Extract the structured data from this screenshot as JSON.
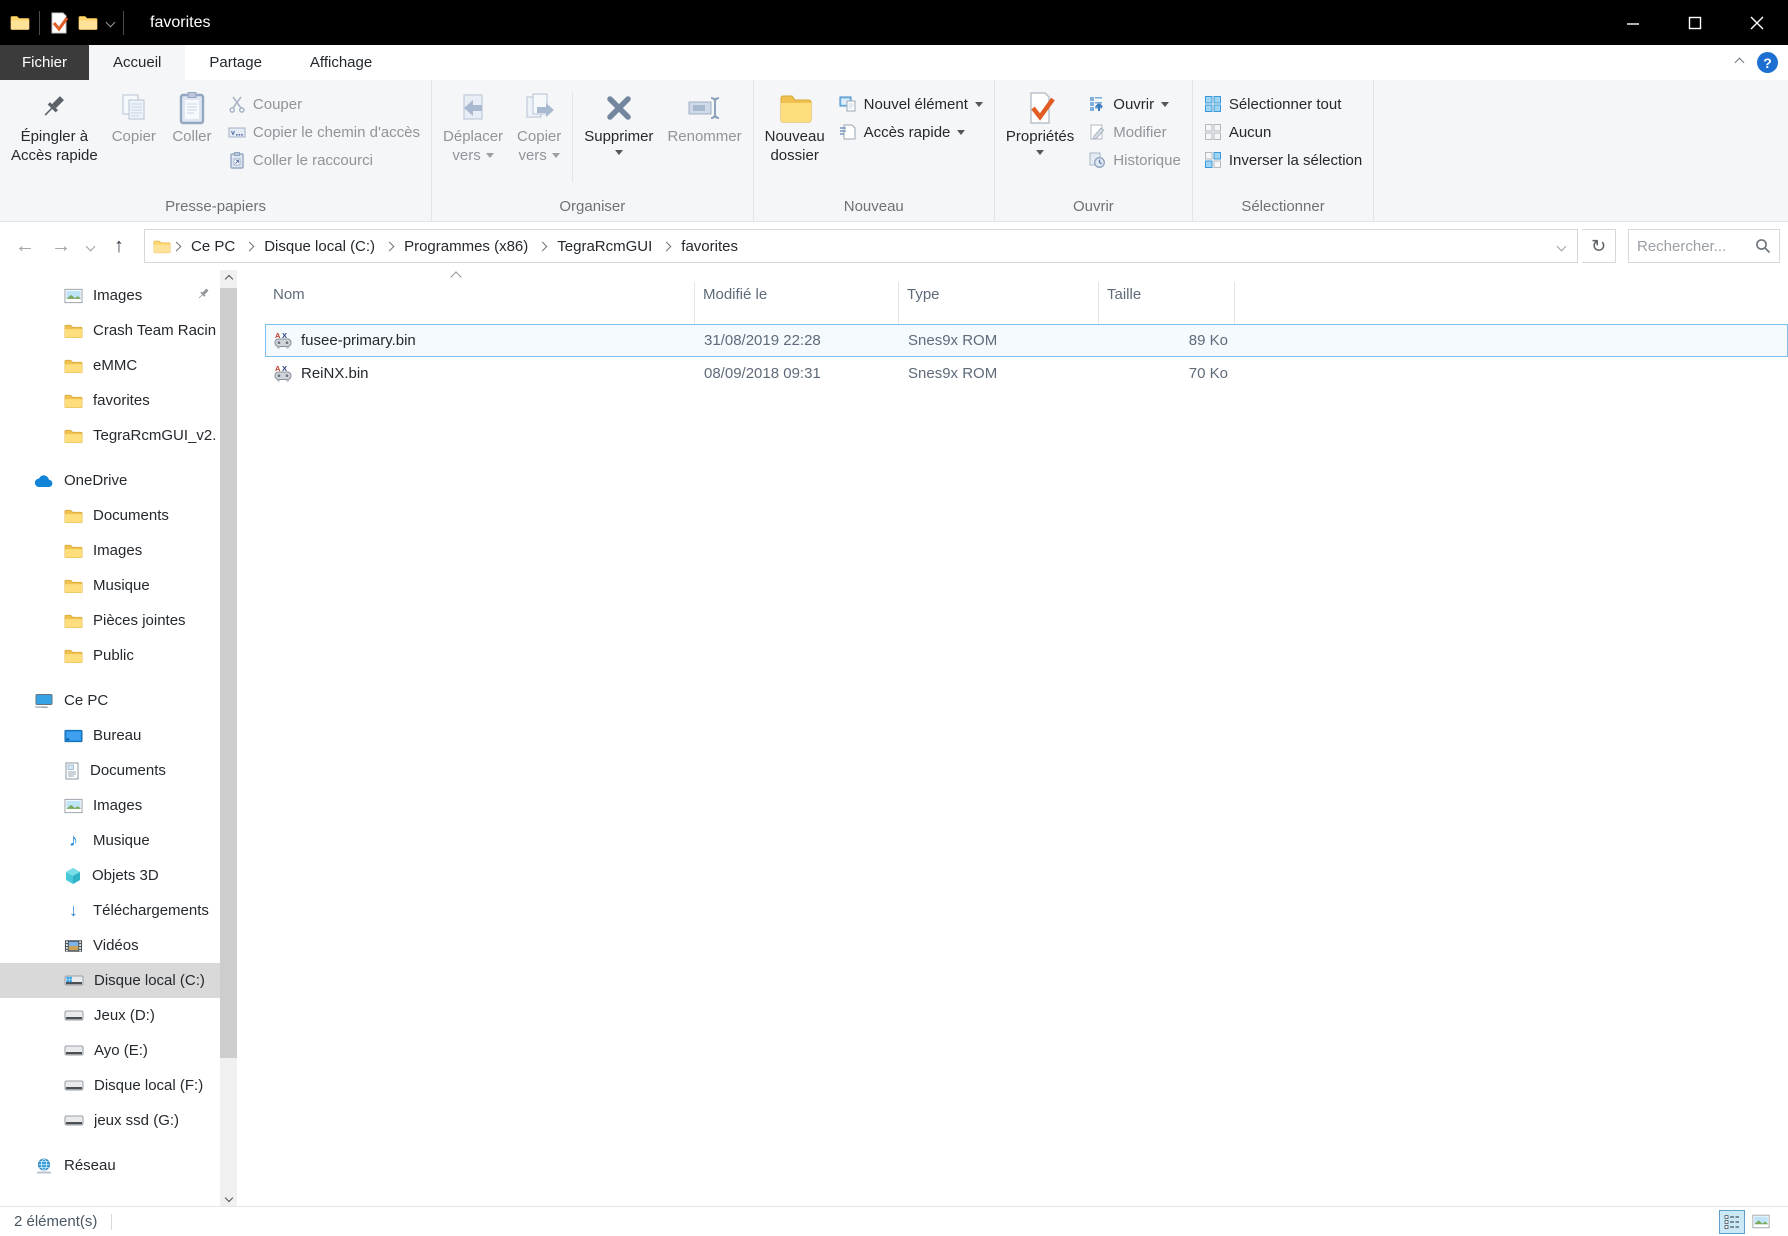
{
  "titlebar": {
    "title": "favorites"
  },
  "tabs": {
    "file": "Fichier",
    "home": "Accueil",
    "share": "Partage",
    "view": "Affichage"
  },
  "ribbon": {
    "clipboard": {
      "label": "Presse-papiers",
      "pin_l1": "Épingler à",
      "pin_l2": "Accès rapide",
      "copy": "Copier",
      "paste": "Coller",
      "cut": "Couper",
      "copy_path": "Copier le chemin d'accès",
      "paste_shortcut": "Coller le raccourci"
    },
    "organize": {
      "label": "Organiser",
      "move_l1": "Déplacer",
      "move_l2": "vers",
      "copyto_l1": "Copier",
      "copyto_l2": "vers",
      "delete": "Supprimer",
      "rename": "Renommer"
    },
    "new": {
      "label": "Nouveau",
      "newfolder_l1": "Nouveau",
      "newfolder_l2": "dossier",
      "new_item": "Nouvel élément",
      "easy_access": "Accès rapide"
    },
    "open": {
      "label": "Ouvrir",
      "properties": "Propriétés",
      "open": "Ouvrir",
      "edit": "Modifier",
      "history": "Historique"
    },
    "select": {
      "label": "Sélectionner",
      "select_all": "Sélectionner tout",
      "select_none": "Aucun",
      "invert": "Inverser la sélection"
    }
  },
  "addressbar": {
    "breadcrumb": [
      "Ce PC",
      "Disque local (C:)",
      "Programmes (x86)",
      "TegraRcmGUI",
      "favorites"
    ],
    "search_placeholder": "Rechercher..."
  },
  "sidebar": {
    "items": [
      {
        "label": "Images"
      },
      {
        "label": "Crash Team Racin"
      },
      {
        "label": "eMMC"
      },
      {
        "label": "favorites"
      },
      {
        "label": "TegraRcmGUI_v2."
      },
      {
        "label": "OneDrive"
      },
      {
        "label": "Documents"
      },
      {
        "label": "Images"
      },
      {
        "label": "Musique"
      },
      {
        "label": "Pièces jointes"
      },
      {
        "label": "Public"
      },
      {
        "label": "Ce PC"
      },
      {
        "label": "Bureau"
      },
      {
        "label": "Documents"
      },
      {
        "label": "Images"
      },
      {
        "label": "Musique"
      },
      {
        "label": "Objets 3D"
      },
      {
        "label": "Téléchargements"
      },
      {
        "label": "Vidéos"
      },
      {
        "label": "Disque local (C:)"
      },
      {
        "label": "Jeux (D:)"
      },
      {
        "label": "Ayo (E:)"
      },
      {
        "label": "Disque local (F:)"
      },
      {
        "label": "jeux ssd (G:)"
      },
      {
        "label": "Réseau"
      }
    ]
  },
  "files": {
    "columns": {
      "name": "Nom",
      "modified": "Modifié le",
      "type": "Type",
      "size": "Taille"
    },
    "rows": [
      {
        "name": "fusee-primary.bin",
        "modified": "31/08/2019 22:28",
        "type": "Snes9x ROM",
        "size": "89 Ko"
      },
      {
        "name": "ReiNX.bin",
        "modified": "08/09/2018 09:31",
        "type": "Snes9x ROM",
        "size": "70 Ko"
      }
    ]
  },
  "statusbar": {
    "count": "2 élément(s)"
  },
  "icons": {
    "back": "←",
    "forward": "→",
    "up": "↑",
    "refresh": "↻",
    "music": "♪",
    "download": "↓",
    "help": "?"
  },
  "colors": {
    "titlebar": "#000000",
    "accent": "#0078d7",
    "selection_border": "#7fc0ea",
    "ribbon_bg": "#f5f6f7"
  }
}
